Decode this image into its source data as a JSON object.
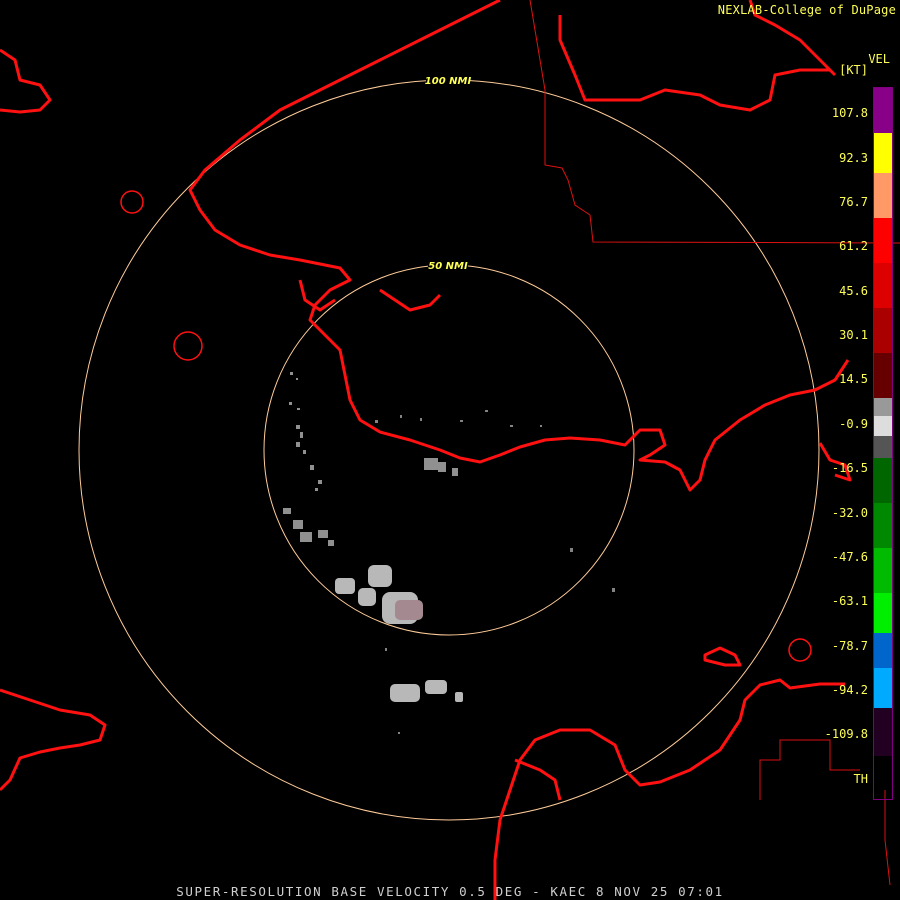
{
  "credit": "NEXLAB-College of DuPage",
  "footer": "SUPER-RESOLUTION BASE VELOCITY 0.5 DEG - KAEC 8 NOV 25 07:01",
  "range_rings": [
    {
      "label": "100 NMI"
    },
    {
      "label": "50 NMI"
    }
  ],
  "legend": {
    "title": "VEL",
    "unit": "[KT]",
    "values": [
      "107.8",
      "92.3",
      "76.7",
      "61.2",
      "45.6",
      "30.1",
      "14.5",
      "-0.9",
      "-16.5",
      "-32.0",
      "-47.6",
      "-63.1",
      "-78.7",
      "-94.2",
      "-109.8"
    ],
    "th_label": "TH",
    "colors": {
      "purple": "#880088",
      "yellow": "#ffff00",
      "orange": "#ff9966",
      "red": "#ff0000",
      "gray": "#999999",
      "green": "#00bb00",
      "blue": "#0066cc",
      "lightblue": "#00aaff",
      "coast": "#ff1111",
      "ring": "#ffcc99"
    }
  }
}
